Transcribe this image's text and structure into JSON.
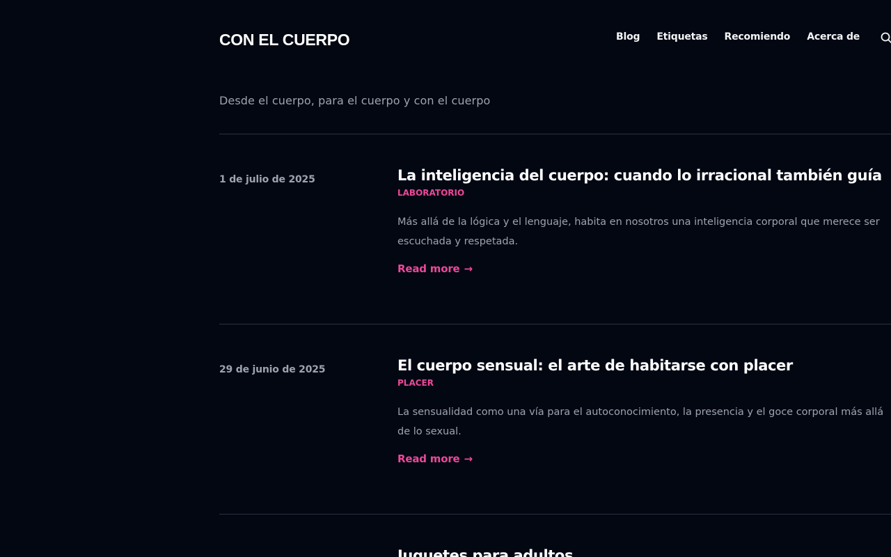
{
  "site": {
    "title": "CON EL CUERPO",
    "tagline": "Desde el cuerpo, para el cuerpo y con el cuerpo"
  },
  "nav": {
    "items": [
      {
        "label": "Blog"
      },
      {
        "label": "Etiquetas"
      },
      {
        "label": "Recomiendo"
      },
      {
        "label": "Acerca de"
      }
    ],
    "search_icon": "search-icon"
  },
  "posts": [
    {
      "date": "1 de julio de 2025",
      "title": "La inteligencia del cuerpo: cuando lo irracional también guía",
      "tag": "LABORATORIO",
      "excerpt": "Más allá de la lógica y el lenguaje, habita en nosotros una inteligencia corporal que merece ser escuchada y respetada.",
      "read_more": "Read more",
      "arrow": "→"
    },
    {
      "date": "29 de junio de 2025",
      "title": "El cuerpo sensual: el arte de habitarse con placer",
      "tag": "PLACER",
      "excerpt": "La sensualidad como una vía para el autoconocimiento, la presencia y el goce corporal más allá de lo sexual.",
      "read_more": "Read more",
      "arrow": "→"
    },
    {
      "title": "Juguetes para adultos"
    }
  ],
  "colors": {
    "background": "#030712",
    "accent": "#ec4899",
    "text": "#ffffff",
    "muted": "#9ca3af",
    "divider": "#2b3140"
  }
}
